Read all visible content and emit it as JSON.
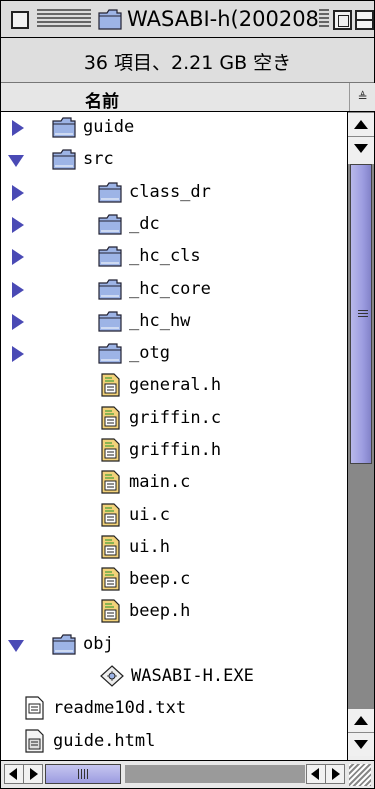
{
  "window": {
    "title": "WASABI-h(200208…",
    "info": "36 項目、2.21 GB 空き"
  },
  "header": {
    "name_col": "名前",
    "sort_glyph": "≜"
  },
  "items": [
    {
      "label": "guide",
      "kind": "folder",
      "indent": 0,
      "toggle": "collapsed"
    },
    {
      "label": "src",
      "kind": "folder",
      "indent": 0,
      "toggle": "expanded"
    },
    {
      "label": "class_dr",
      "kind": "folder",
      "indent": 1,
      "toggle": "collapsed"
    },
    {
      "label": "_dc",
      "kind": "folder",
      "indent": 1,
      "toggle": "collapsed"
    },
    {
      "label": "_hc_cls",
      "kind": "folder",
      "indent": 1,
      "toggle": "collapsed"
    },
    {
      "label": "_hc_core",
      "kind": "folder",
      "indent": 1,
      "toggle": "collapsed"
    },
    {
      "label": "_hc_hw",
      "kind": "folder",
      "indent": 1,
      "toggle": "collapsed"
    },
    {
      "label": "_otg",
      "kind": "folder",
      "indent": 1,
      "toggle": "collapsed"
    },
    {
      "label": "general.h",
      "kind": "source",
      "indent": 1,
      "toggle": "none"
    },
    {
      "label": "griffin.c",
      "kind": "source",
      "indent": 1,
      "toggle": "none"
    },
    {
      "label": "griffin.h",
      "kind": "source",
      "indent": 1,
      "toggle": "none"
    },
    {
      "label": "main.c",
      "kind": "source",
      "indent": 1,
      "toggle": "none"
    },
    {
      "label": "ui.c",
      "kind": "source",
      "indent": 1,
      "toggle": "none"
    },
    {
      "label": "ui.h",
      "kind": "source",
      "indent": 1,
      "toggle": "none"
    },
    {
      "label": "beep.c",
      "kind": "source",
      "indent": 1,
      "toggle": "none"
    },
    {
      "label": "beep.h",
      "kind": "source",
      "indent": 1,
      "toggle": "none"
    },
    {
      "label": "obj",
      "kind": "folder",
      "indent": 0,
      "toggle": "expanded"
    },
    {
      "label": "WASABI-H.EXE",
      "kind": "app",
      "indent": 1,
      "toggle": "none"
    },
    {
      "label": "readme10d.txt",
      "kind": "text",
      "indent": 0,
      "toggle": "none"
    },
    {
      "label": "guide.html",
      "kind": "html",
      "indent": 0,
      "toggle": "none"
    }
  ],
  "colors": {
    "accent": "#4a4ab5",
    "folder": "#9db4e6",
    "scroll_thumb": "#a6a6e2",
    "chrome": "#dddddd"
  }
}
